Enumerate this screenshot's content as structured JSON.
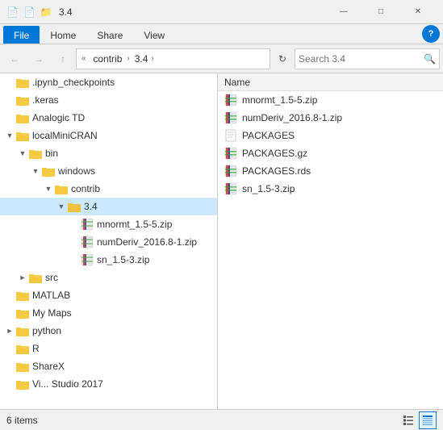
{
  "titleBar": {
    "icons": [
      "📄",
      "📄",
      "📁"
    ],
    "title": "3.4",
    "minimize": "—",
    "maximize": "□",
    "close": "✕"
  },
  "ribbonTabs": [
    {
      "label": "File",
      "active": true
    },
    {
      "label": "Home",
      "active": false
    },
    {
      "label": "Share",
      "active": false
    },
    {
      "label": "View",
      "active": false
    }
  ],
  "help": "?",
  "navBar": {
    "backDisabled": false,
    "forwardDisabled": false,
    "upDisabled": false,
    "breadcrumbs": [
      "contrib",
      "3.4"
    ],
    "refreshTitle": "Refresh",
    "searchPlaceholder": "Search 3.4"
  },
  "tree": {
    "items": [
      {
        "id": "ipynb",
        "label": ".ipynb_checkpoints",
        "indent": 0,
        "expanded": false,
        "hasChildren": false
      },
      {
        "id": "keras",
        "label": ".keras",
        "indent": 0,
        "expanded": false,
        "hasChildren": false
      },
      {
        "id": "analogic",
        "label": "Analogic TD",
        "indent": 0,
        "expanded": false,
        "hasChildren": false
      },
      {
        "id": "localMiniCRAN",
        "label": "localMiniCRAN",
        "indent": 0,
        "expanded": true,
        "hasChildren": true
      },
      {
        "id": "bin",
        "label": "bin",
        "indent": 1,
        "expanded": true,
        "hasChildren": true
      },
      {
        "id": "windows",
        "label": "windows",
        "indent": 2,
        "expanded": true,
        "hasChildren": true
      },
      {
        "id": "contrib",
        "label": "contrib",
        "indent": 3,
        "expanded": true,
        "hasChildren": true
      },
      {
        "id": "34",
        "label": "3.4",
        "indent": 4,
        "expanded": true,
        "hasChildren": true,
        "selected": true
      },
      {
        "id": "mnormt",
        "label": "mnormt_1.5-5.zip",
        "indent": 5,
        "expanded": false,
        "hasChildren": false,
        "isFile": true
      },
      {
        "id": "numDeriv",
        "label": "numDeriv_2016.8-1.zip",
        "indent": 5,
        "expanded": false,
        "hasChildren": false,
        "isFile": true
      },
      {
        "id": "sn",
        "label": "sn_1.5-3.zip",
        "indent": 5,
        "expanded": false,
        "hasChildren": false,
        "isFile": true
      },
      {
        "id": "src",
        "label": "src",
        "indent": 1,
        "expanded": false,
        "hasChildren": true
      },
      {
        "id": "matlab",
        "label": "MATLAB",
        "indent": 0,
        "expanded": false,
        "hasChildren": false
      },
      {
        "id": "mymaps",
        "label": "My Maps",
        "indent": 0,
        "expanded": false,
        "hasChildren": false
      },
      {
        "id": "python",
        "label": "python",
        "indent": 0,
        "expanded": false,
        "hasChildren": true
      },
      {
        "id": "r",
        "label": "R",
        "indent": 0,
        "expanded": false,
        "hasChildren": false
      },
      {
        "id": "sharex",
        "label": "ShareX",
        "indent": 0,
        "expanded": false,
        "hasChildren": false
      },
      {
        "id": "visualstudio",
        "label": "Vi... Studio 2017",
        "indent": 0,
        "expanded": false,
        "hasChildren": false
      }
    ]
  },
  "fileList": {
    "columnHeader": "Name",
    "files": [
      {
        "id": "mnormt",
        "name": "mnormt_1.5-5.zip",
        "type": "zip"
      },
      {
        "id": "numDeriv",
        "name": "numDeriv_2016.8-1.zip",
        "type": "zip"
      },
      {
        "id": "packages",
        "name": "PACKAGES",
        "type": "plain"
      },
      {
        "id": "packagesgz",
        "name": "PACKAGES.gz",
        "type": "gz"
      },
      {
        "id": "packagesrds",
        "name": "PACKAGES.rds",
        "type": "rds"
      },
      {
        "id": "sn",
        "name": "sn_1.5-3.zip",
        "type": "zip"
      }
    ]
  },
  "statusBar": {
    "count": "6 items",
    "views": [
      "list",
      "details"
    ]
  }
}
